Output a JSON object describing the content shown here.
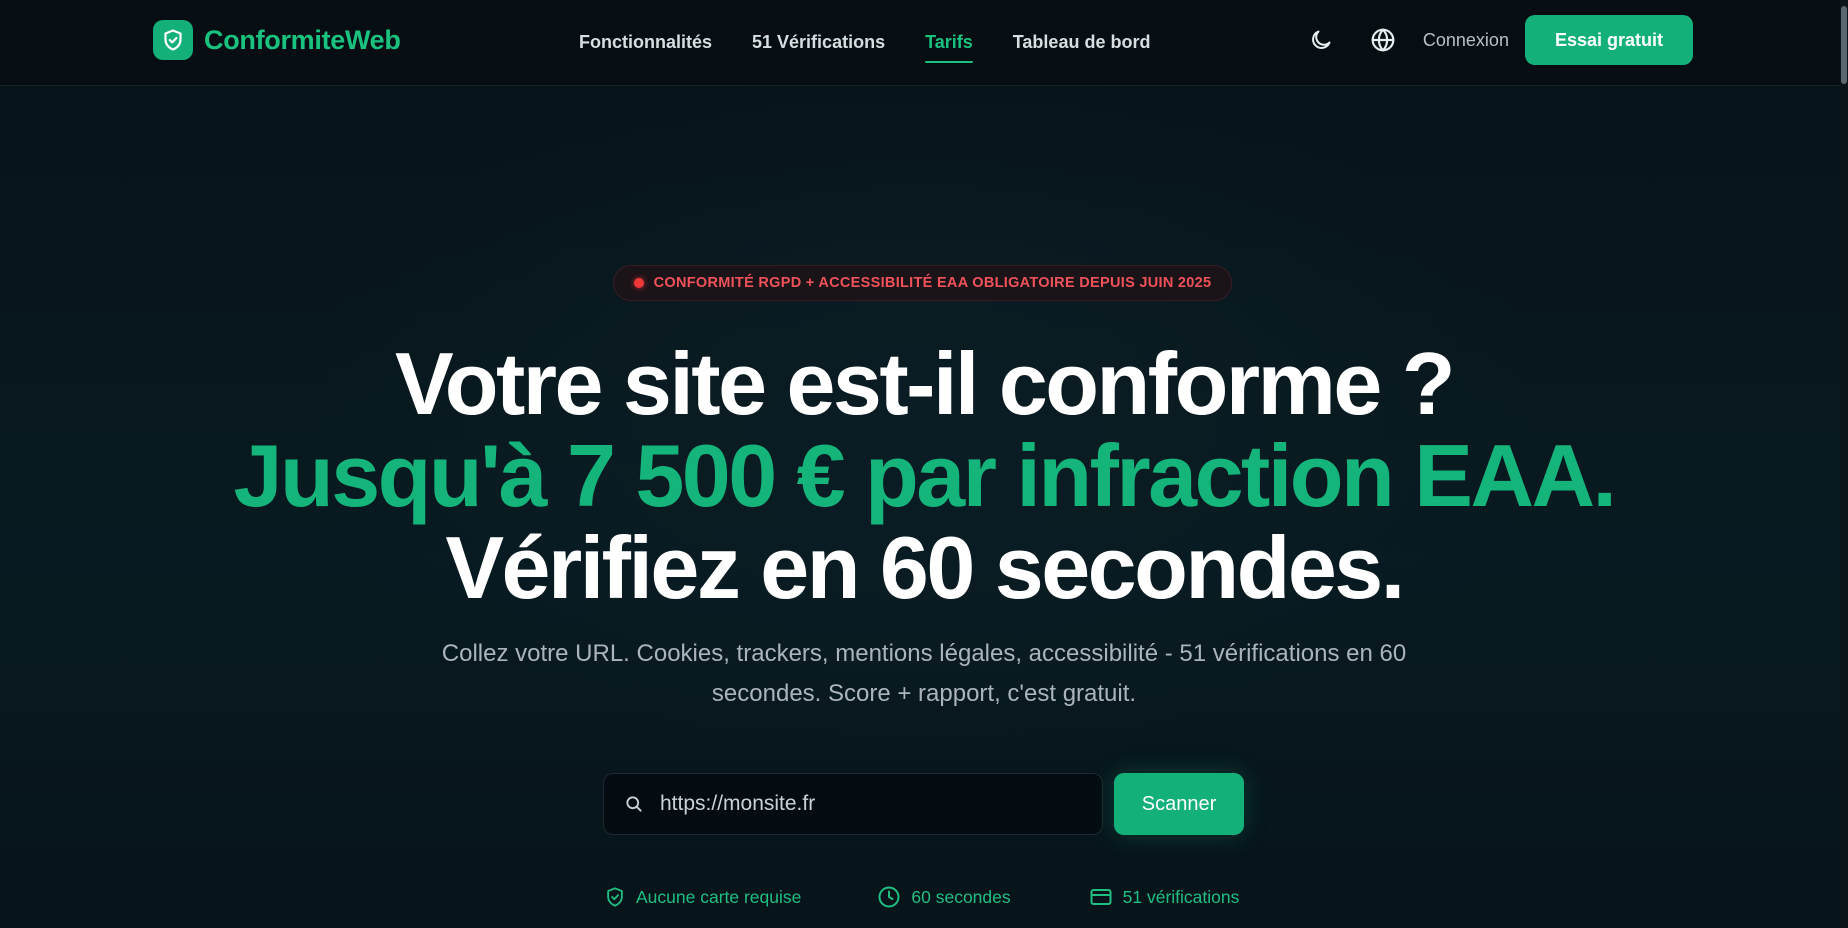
{
  "header": {
    "logo_text": "ConformiteWeb",
    "nav": [
      {
        "label": "Fonctionnalités",
        "active": false
      },
      {
        "label": "51 Vérifications",
        "active": false
      },
      {
        "label": "Tarifs",
        "active": true
      },
      {
        "label": "Tableau de bord",
        "active": false
      }
    ],
    "theme_icon": "moon-icon",
    "language_icon": "globe-icon",
    "login_label": "Connexion",
    "cta_label": "Essai gratuit"
  },
  "hero": {
    "badge": "CONFORMITÉ RGPD + ACCESSIBILITÉ EAA OBLIGATOIRE DEPUIS JUIN 2025",
    "headline_line1": "Votre site est-il conforme ?",
    "headline_green": "Jusqu'à 7 500 € par infraction EAA.",
    "headline_end": "Vérifiez en 60 secondes.",
    "subtitle": "Collez votre URL. Cookies, trackers, mentions légales, accessibilité - 51 vérifications en 60 secondes. Score + rapport, c'est gratuit.",
    "search_placeholder": "https://monsite.fr",
    "scan_label": "Scanner",
    "features": [
      {
        "icon": "shield-check-icon",
        "label": "Aucune carte requise"
      },
      {
        "icon": "clock-icon",
        "label": "60 secondes"
      },
      {
        "icon": "credit-card-icon",
        "label": "51 vérifications"
      }
    ]
  },
  "colors": {
    "accent": "#14b07a",
    "accent_text": "#19c27f",
    "badge_red": "#f0525a",
    "background": "#07151b"
  }
}
